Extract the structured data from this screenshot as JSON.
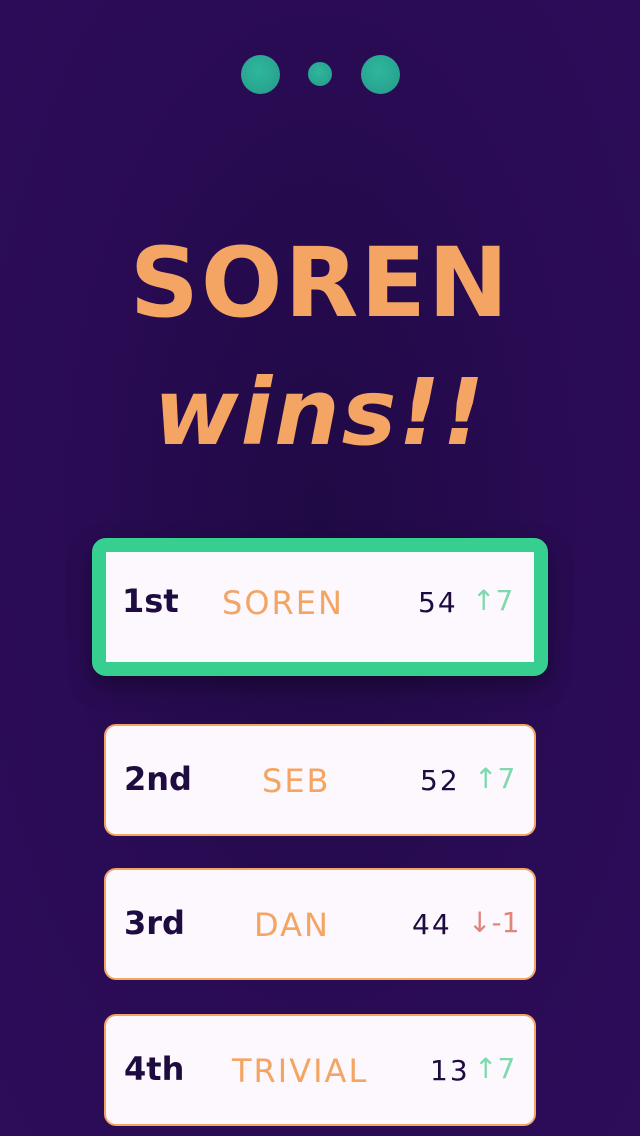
{
  "pagination": {
    "dots": [
      "active",
      "inactive",
      "active"
    ]
  },
  "headline": {
    "winner": "SOREN",
    "wins": "wins!!"
  },
  "leaderboard": [
    {
      "rank": "1st",
      "name": "SOREN",
      "score": "54",
      "delta": "↑7",
      "direction": "up"
    },
    {
      "rank": "2nd",
      "name": "SEB",
      "score": "52",
      "delta": "↑7",
      "direction": "up"
    },
    {
      "rank": "3rd",
      "name": "DAN",
      "score": "44",
      "delta": "↓-1",
      "direction": "down"
    },
    {
      "rank": "4th",
      "name": "TRIVIAL",
      "score": "13",
      "delta": "↑7",
      "direction": "up"
    }
  ],
  "colors": {
    "background": "#2a0b55",
    "accent_orange": "#f4a463",
    "winner_border": "#36cf8f",
    "dot": "#2aa893",
    "up": "#7fd9ad",
    "down": "#e0857a",
    "rank_text": "#1e0b3f"
  }
}
